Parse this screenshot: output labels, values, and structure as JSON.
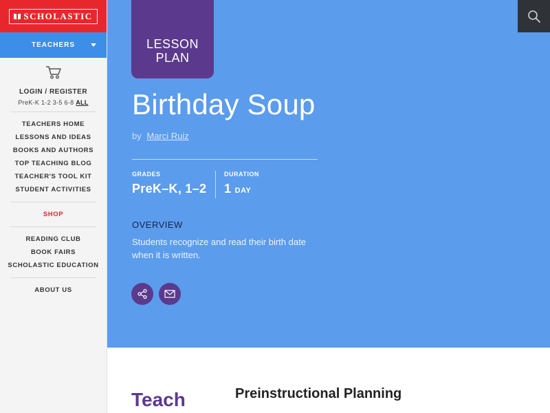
{
  "sidebar": {
    "brand": "SCHOLASTIC",
    "role_selector": "TEACHERS",
    "account_link": "LOGIN / REGISTER",
    "grade_links": [
      "PreK-K",
      "1-2",
      "3-5",
      "6-8",
      "ALL"
    ],
    "nav_primary": [
      "TEACHERS HOME",
      "LESSONS AND IDEAS",
      "BOOKS AND AUTHORS",
      "TOP TEACHING BLOG",
      "TEACHER'S TOOL KIT",
      "STUDENT ACTIVITIES"
    ],
    "shop": "SHOP",
    "nav_secondary": [
      "READING CLUB",
      "BOOK FAIRS",
      "SCHOLASTIC EDUCATION"
    ],
    "about": "ABOUT US"
  },
  "hero": {
    "tag_line1": "LESSON",
    "tag_line2": "PLAN",
    "title": "Birthday Soup",
    "by_prefix": "by",
    "author": "Marci  Ruiz",
    "grades_label": "GRADES",
    "grades_value": "PreK–K, 1–2",
    "duration_label": "DURATION",
    "duration_number": "1",
    "duration_unit": "DAY",
    "overview_heading": "OVERVIEW",
    "overview_text": "Students recognize and read their birth date when it is written."
  },
  "content": {
    "teach_heading": "Teach",
    "section_heading": "Preinstructional Planning"
  },
  "colors": {
    "brand_red": "#e8272d",
    "role_blue": "#3d8ee8",
    "hero_blue": "#5b9cec",
    "purple": "#5b3a8d",
    "search_dark": "#2f3337"
  },
  "icons": [
    "cart-icon",
    "search-icon",
    "share-icon",
    "email-icon",
    "chevron-down-icon"
  ]
}
